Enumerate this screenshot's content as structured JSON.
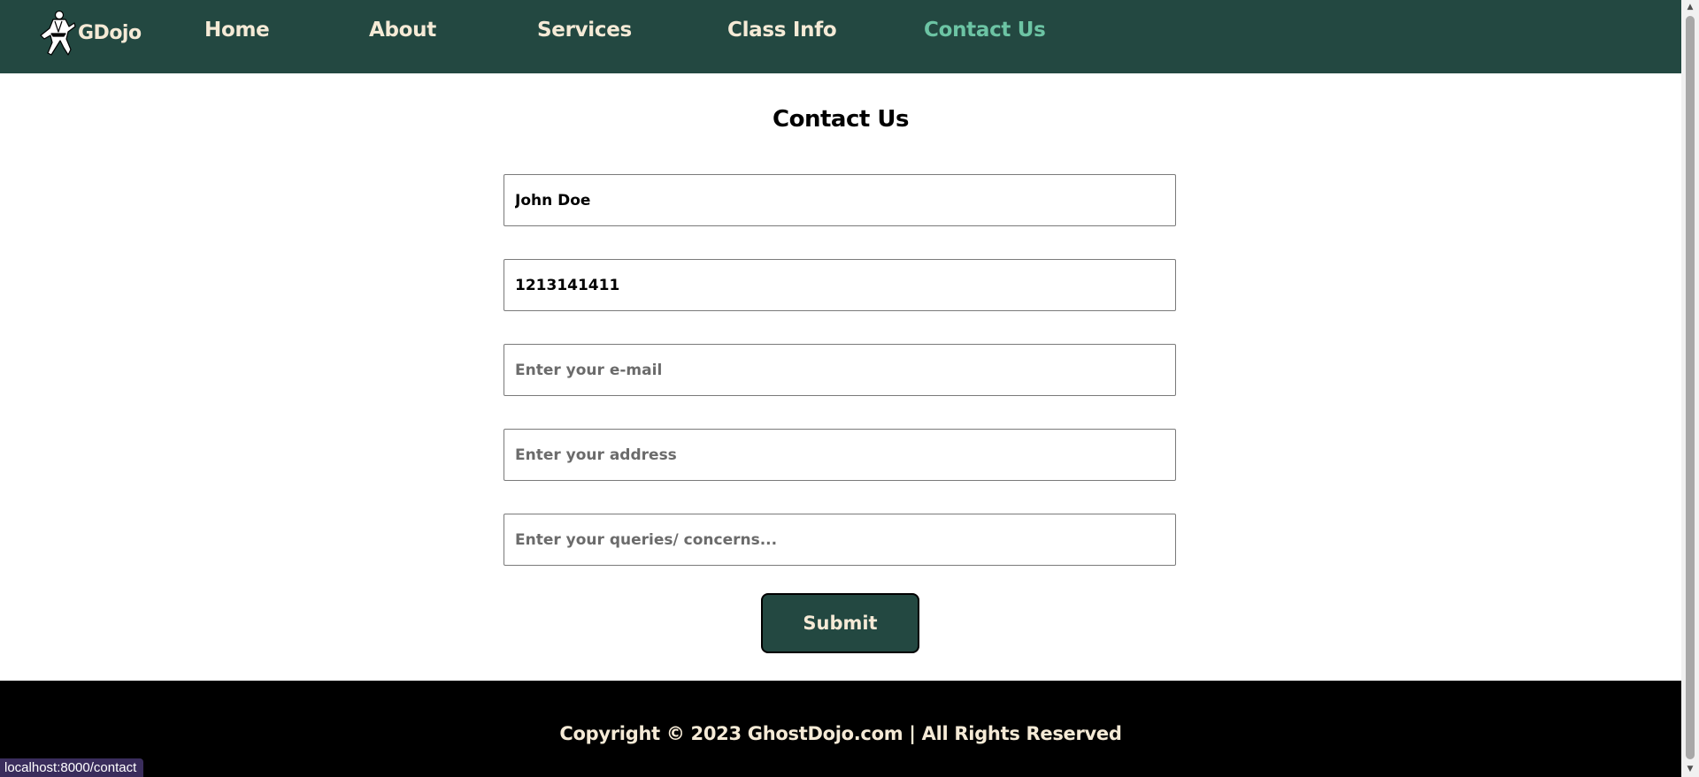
{
  "nav": {
    "brand": "GDojo",
    "brand_icon": "martial-artist-logo-icon",
    "links": [
      {
        "label": "Home",
        "active": false
      },
      {
        "label": "About",
        "active": false
      },
      {
        "label": "Services",
        "active": false
      },
      {
        "label": "Class Info",
        "active": false
      },
      {
        "label": "Contact Us",
        "active": true
      }
    ]
  },
  "page": {
    "title": "Contact Us"
  },
  "form": {
    "name": {
      "value": "John Doe",
      "placeholder": ""
    },
    "phone": {
      "value": "1213141411",
      "placeholder": ""
    },
    "email": {
      "value": "",
      "placeholder": "Enter your e-mail"
    },
    "address": {
      "value": "",
      "placeholder": "Enter your address"
    },
    "queries": {
      "value": "",
      "placeholder": "Enter your queries/ concerns..."
    },
    "submit_label": "Submit"
  },
  "footer": {
    "copyright": "Copyright © 2023 GhostDojo.com | All Rights Reserved"
  },
  "status_bar": {
    "url": "localhost:8000/contact"
  },
  "colors": {
    "nav_background": "#234841",
    "nav_text": "#f5ead6",
    "nav_active": "#6cc4a4",
    "footer_background": "#000000",
    "button_background": "#234841"
  }
}
